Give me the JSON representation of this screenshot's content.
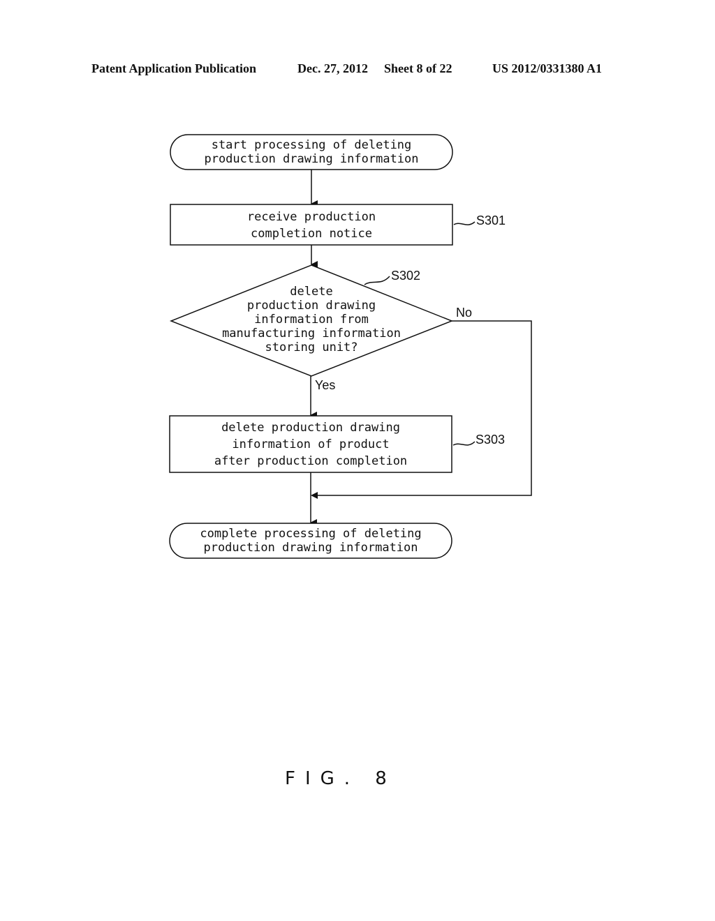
{
  "header": {
    "publication": "Patent Application Publication",
    "date": "Dec. 27, 2012",
    "sheet": "Sheet 8 of 22",
    "number": "US 2012/0331380 A1"
  },
  "flowchart": {
    "start": {
      "lines": [
        "start processing of deleting",
        "production drawing information"
      ]
    },
    "steps": [
      {
        "id": "S301",
        "type": "process",
        "lines": [
          "receive production",
          "completion notice"
        ]
      },
      {
        "id": "S302",
        "type": "decision",
        "lines": [
          "delete",
          "production drawing",
          "information from",
          "manufacturing information",
          "storing unit?"
        ]
      },
      {
        "id": "S303",
        "type": "process",
        "lines": [
          "delete production drawing",
          "information of product",
          "after production completion"
        ]
      }
    ],
    "branches": {
      "yes": "Yes",
      "no": "No"
    },
    "end": {
      "lines": [
        "complete processing of deleting",
        "production drawing information"
      ]
    }
  },
  "figure_label": "FIG. 8"
}
